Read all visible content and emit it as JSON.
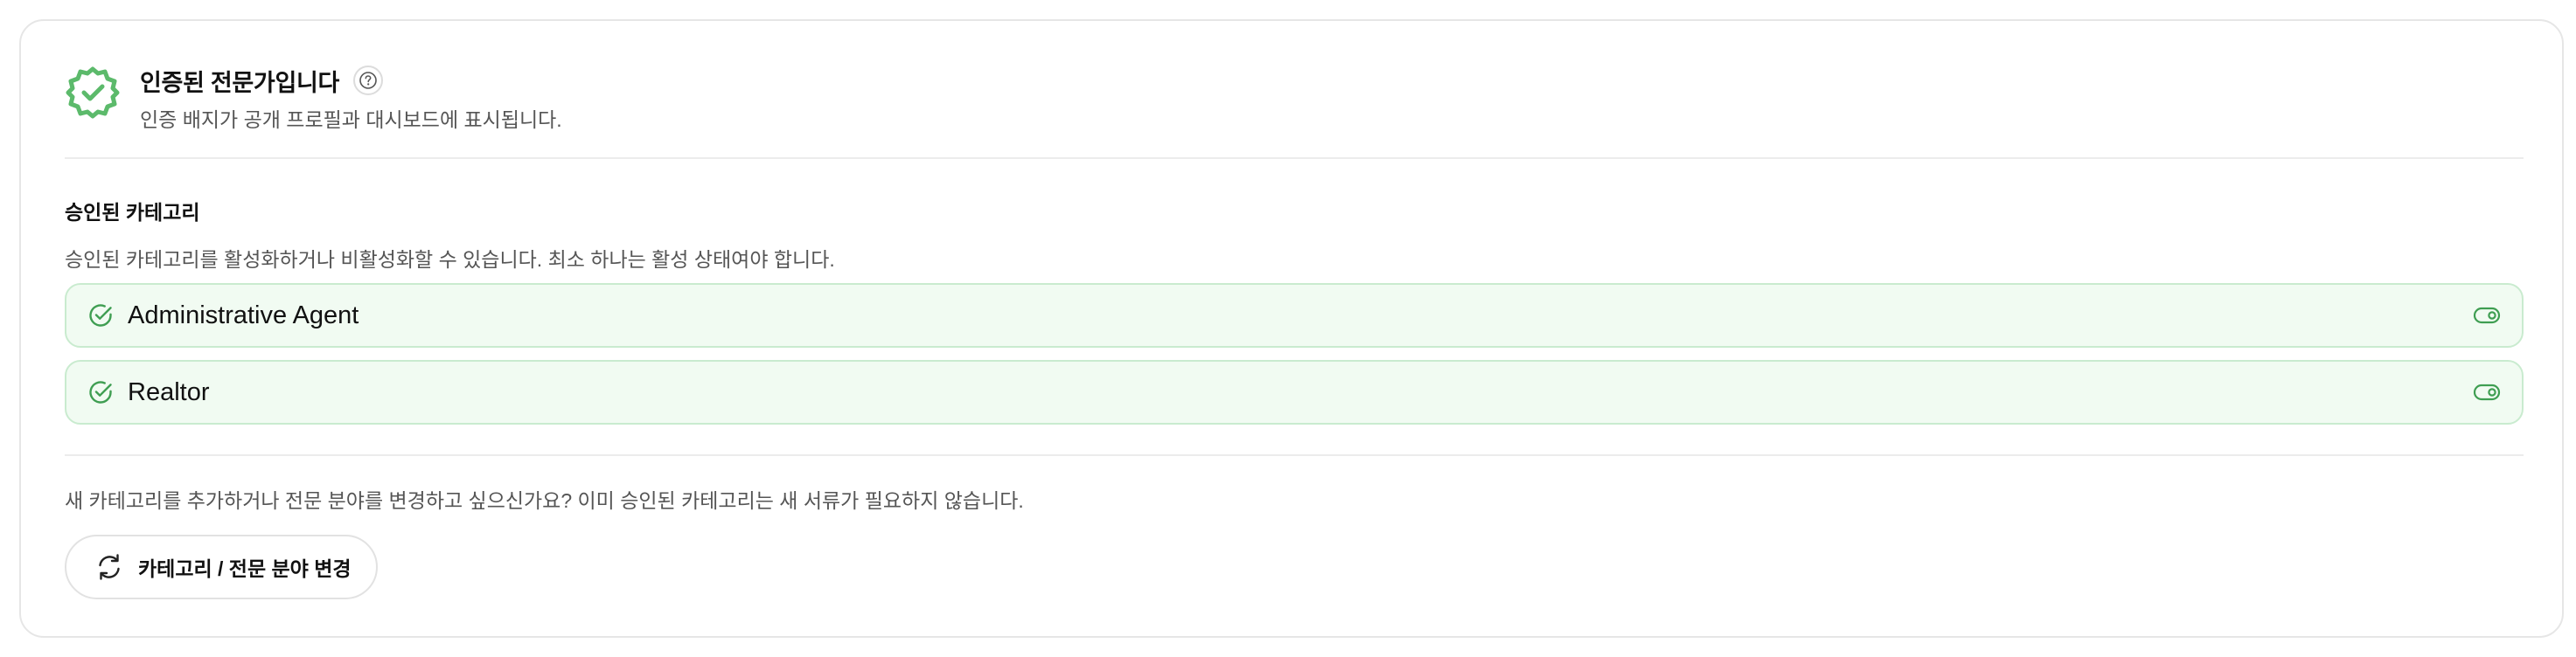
{
  "verification": {
    "title": "인증된 전문가입니다",
    "subtitle": "인증 배지가 공개 프로필과 대시보드에 표시됩니다.",
    "badge_icon": "verified-badge-icon",
    "help_icon": "help-circle-icon",
    "accent_color": "#5cba6b"
  },
  "categories": {
    "title": "승인된 카테고리",
    "description": "승인된 카테고리를 활성화하거나 비활성화할 수 있습니다. 최소 하나는 활성 상태여야 합니다.",
    "items": [
      {
        "label": "Administrative Agent",
        "active": true
      },
      {
        "label": "Realtor",
        "active": true
      }
    ]
  },
  "change": {
    "prompt": "새 카테고리를 추가하거나 전문 분야를 변경하고 싶으신가요? 이미 승인된 카테고리는 새 서류가 필요하지 않습니다.",
    "button_label": "카테고리 / 전문 분야 변경",
    "button_icon": "refresh-icon"
  },
  "colors": {
    "accent": "#5cba6b",
    "item_bg": "#f1fbf2",
    "item_border": "#c9ebcf"
  }
}
